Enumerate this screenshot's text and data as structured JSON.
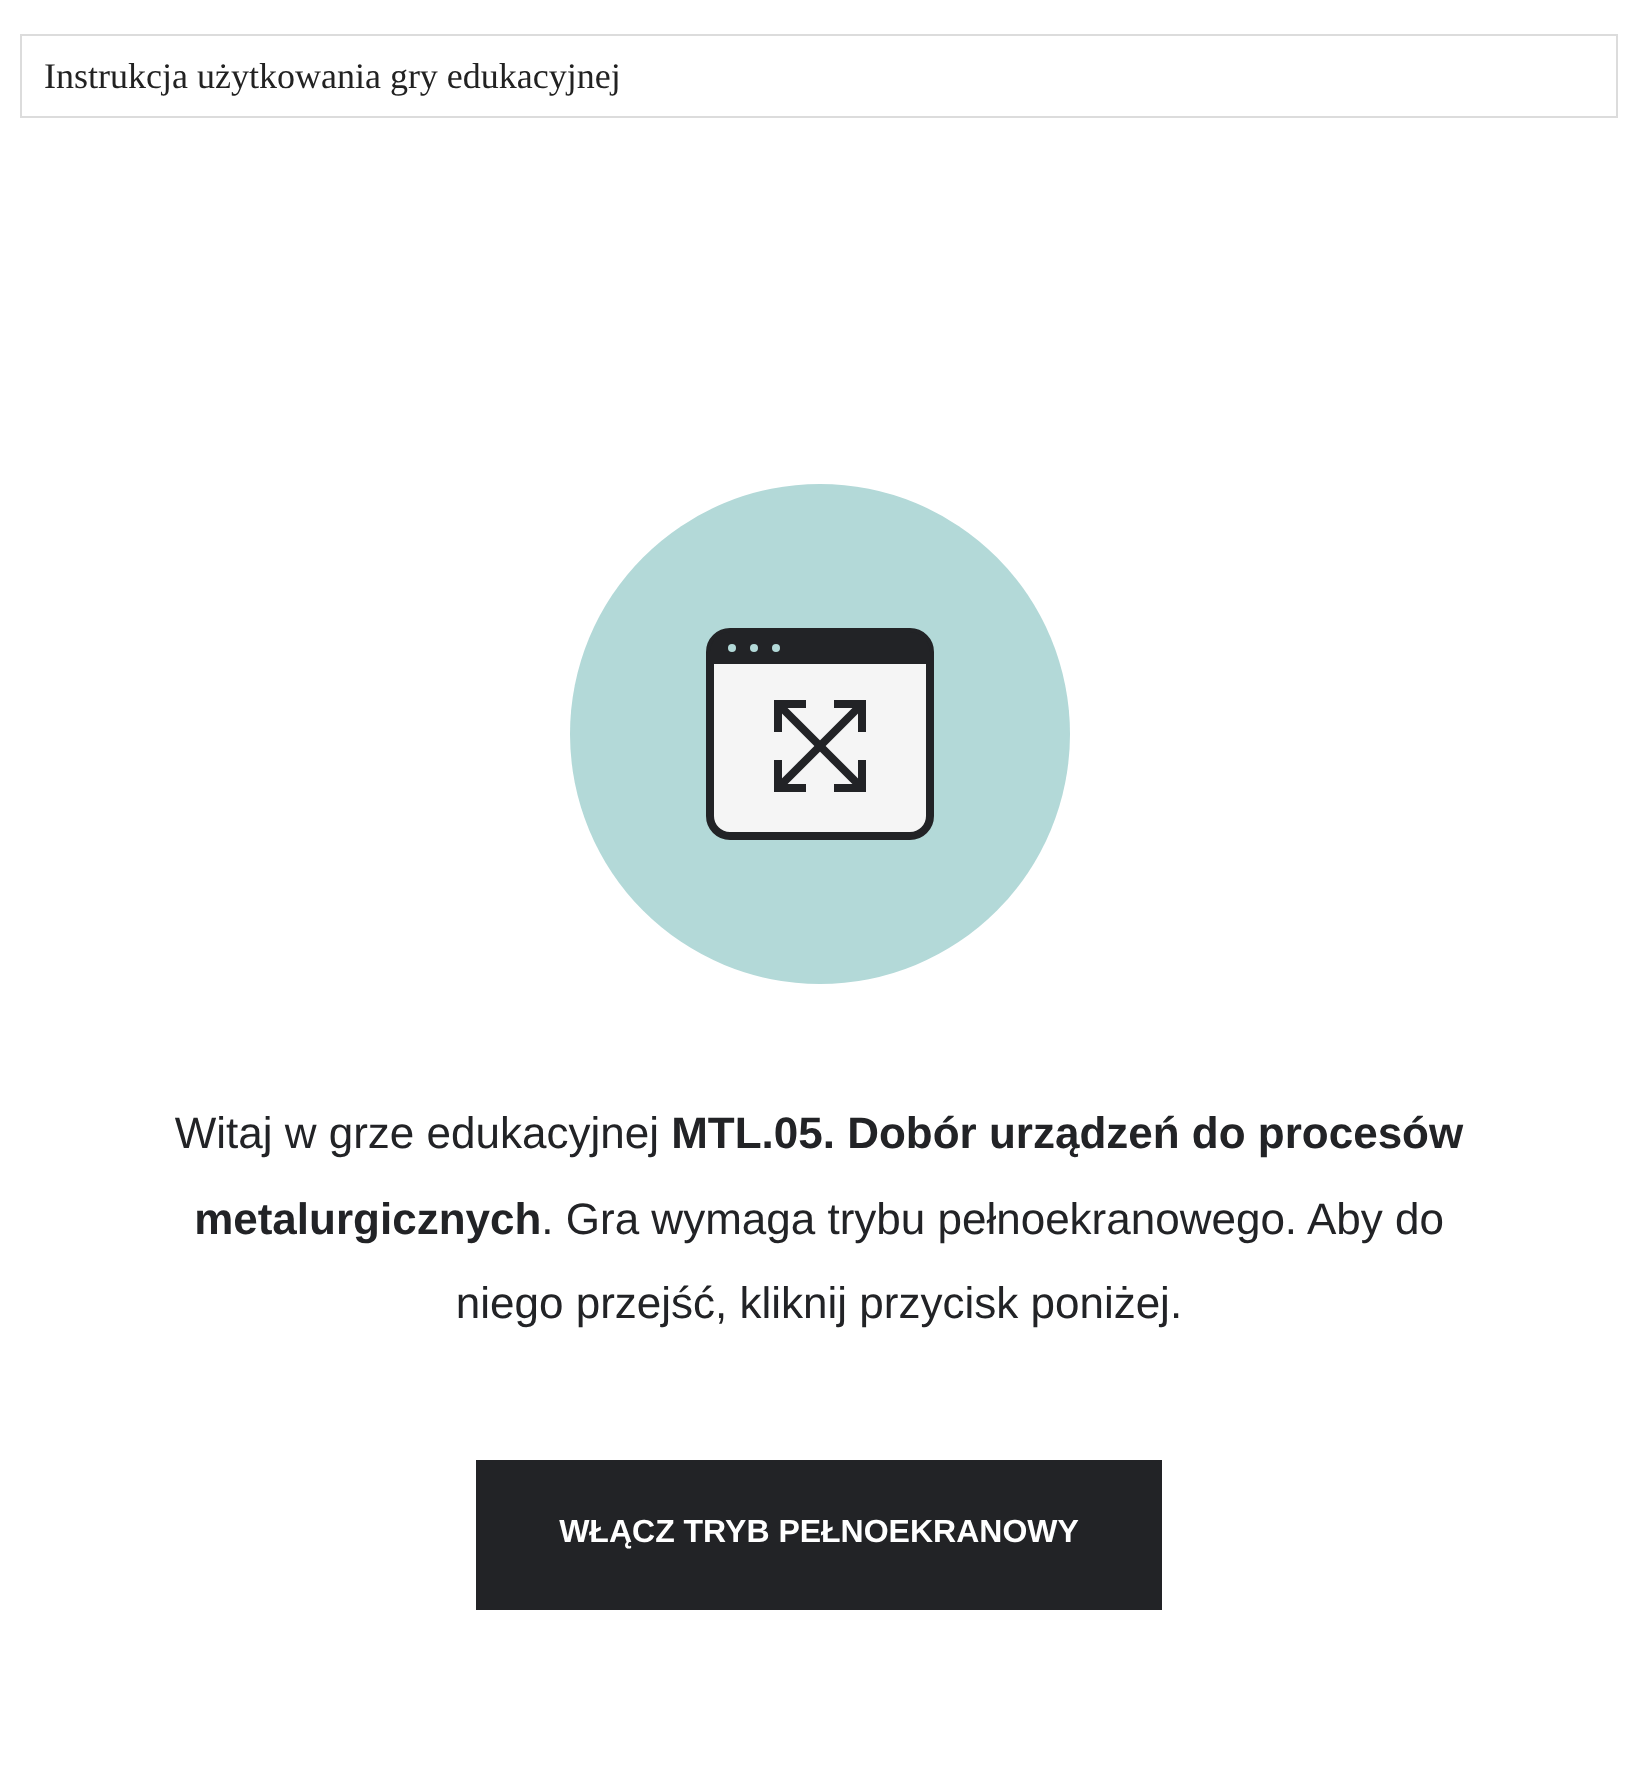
{
  "header": {
    "title": "Instrukcja użytkowania gry edukacyjnej"
  },
  "intro": {
    "text": "Witaj w grze edukacyjnej **MTL.05. Dobór urządzeń do procesów metalurgicznych**. Gra wymaga trybu pełnoekranowego. Aby do niego przejść, kliknij przycisk poniżej."
  },
  "button": {
    "label": "WŁĄCZ TRYB PEŁNOEKRANOWY"
  }
}
